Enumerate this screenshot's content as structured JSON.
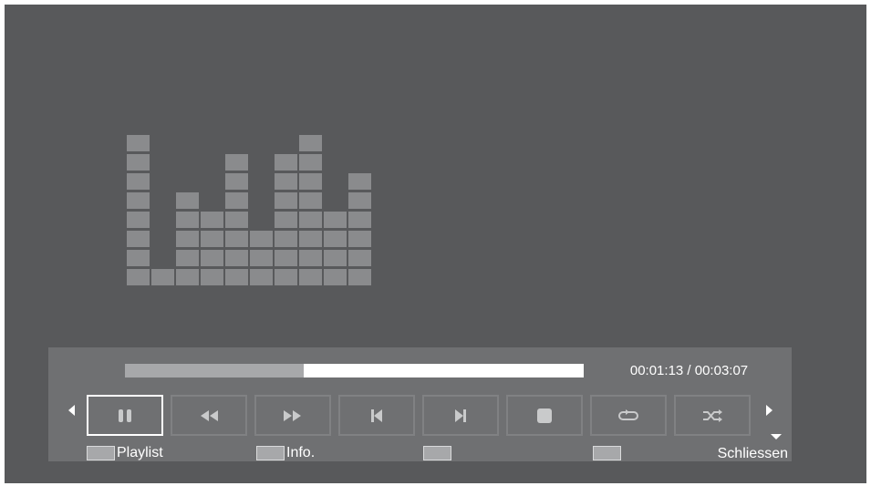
{
  "player": {
    "elapsed": "00:01:13",
    "duration": "00:03:07",
    "time_display": "00:01:13 / 00:03:07",
    "progress_fraction": 0.39
  },
  "equalizer": {
    "bar_levels": [
      8,
      1,
      5,
      4,
      7,
      3,
      7,
      8,
      4,
      6
    ],
    "bar_color": "#8a8b8d"
  },
  "controls": [
    {
      "name": "pause-button",
      "icon": "pause-icon",
      "selected": true
    },
    {
      "name": "rewind-button",
      "icon": "rewind-icon",
      "selected": false
    },
    {
      "name": "fast-forward-button",
      "icon": "fast-forward-icon",
      "selected": false
    },
    {
      "name": "previous-track-button",
      "icon": "skip-previous-icon",
      "selected": false
    },
    {
      "name": "next-track-button",
      "icon": "skip-next-icon",
      "selected": false
    },
    {
      "name": "stop-button",
      "icon": "stop-icon",
      "selected": false
    },
    {
      "name": "repeat-button",
      "icon": "repeat-icon",
      "selected": false
    },
    {
      "name": "shuffle-button",
      "icon": "shuffle-icon",
      "selected": false
    }
  ],
  "legend": {
    "playlist_label": "Playlist",
    "info_label": "Info.",
    "third_label": "",
    "fourth_label": "",
    "close_label": "Schliessen"
  },
  "colors": {
    "background": "#58595b",
    "panel": "#6f7072",
    "progress_played": "#a7a8aa",
    "progress_remaining": "#ffffff",
    "icon": "#c9cacb"
  }
}
